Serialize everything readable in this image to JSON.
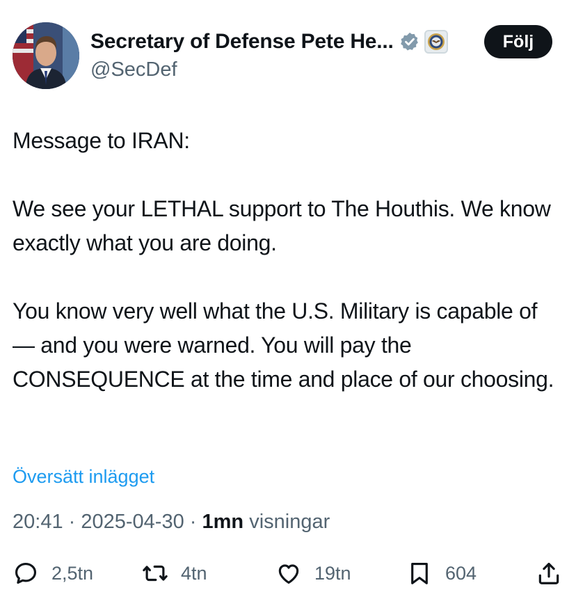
{
  "profile": {
    "display_name": "Secretary of Defense Pete He...",
    "handle": "@SecDef",
    "follow_label": "Följ"
  },
  "tweet": {
    "text": "Message to IRAN:\n\nWe see your LETHAL support to The Houthis. We know exactly what you are doing.\n\nYou know very well what the U.S. Military is capable of — and you were warned. You will pay the CONSEQUENCE at the time and place of our choosing."
  },
  "translate_label": "Översätt inlägget",
  "meta": {
    "time": "20:41",
    "date": "2025-04-30",
    "separator": " · ",
    "views": "1mn",
    "views_label": "visningar"
  },
  "actions": {
    "replies": "2,5tn",
    "reposts": "4tn",
    "likes": "19tn",
    "bookmarks": "604"
  },
  "colors": {
    "text": "#0f1419",
    "secondary": "#536471",
    "link": "#1d9bf0",
    "verified_badge": "#829aab"
  },
  "icons": [
    "verified-badge-icon",
    "department-of-defense-seal-icon",
    "reply-icon",
    "repost-icon",
    "like-icon",
    "bookmark-icon",
    "share-icon"
  ]
}
